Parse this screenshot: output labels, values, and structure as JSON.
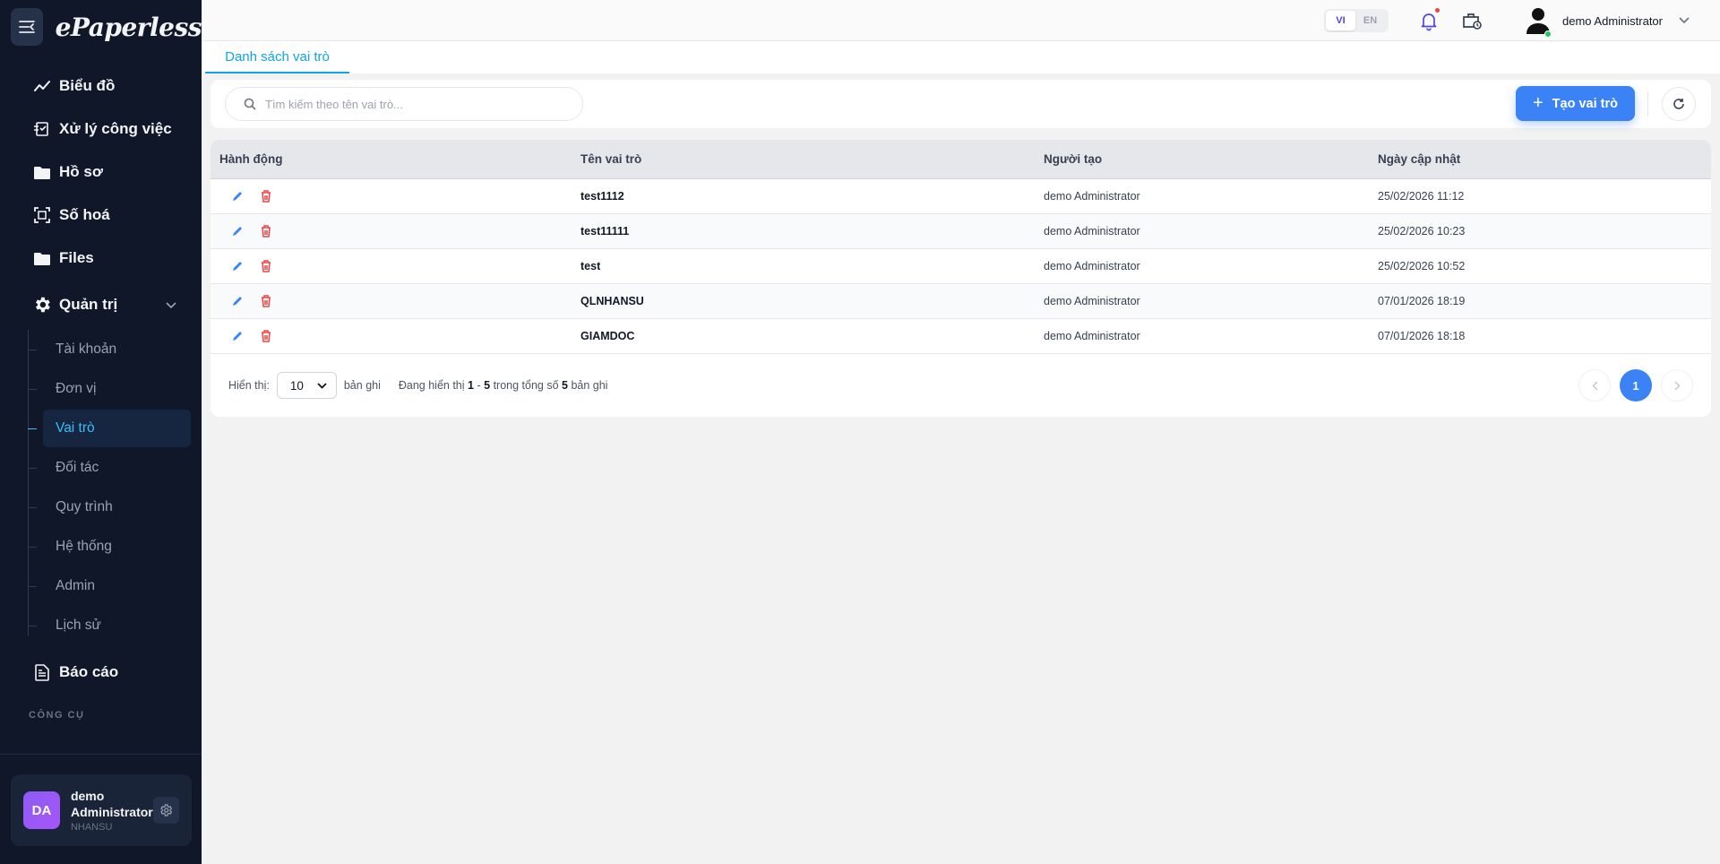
{
  "app": {
    "logo": "ePaperless"
  },
  "sidebar": {
    "items": [
      {
        "label": "Biểu đồ",
        "icon": "chart-line-icon"
      },
      {
        "label": "Xử lý công việc",
        "icon": "task-icon"
      },
      {
        "label": "Hồ sơ",
        "icon": "folder-icon"
      },
      {
        "label": "Số hoá",
        "icon": "scan-icon"
      },
      {
        "label": "Files",
        "icon": "folder-icon"
      }
    ],
    "admin_group": {
      "label": "Quản trị",
      "icon": "gear-icon",
      "children": [
        "Tài khoản",
        "Đơn vị",
        "Vai trò",
        "Đối tác",
        "Quy trình",
        "Hệ thống",
        "Admin",
        "Lịch sử"
      ],
      "active": "Vai trò"
    },
    "report": {
      "label": "Báo cáo",
      "icon": "report-icon"
    },
    "section_tools": "CÔNG CỤ",
    "user_card": {
      "initials": "DA",
      "name": "demo Administrator",
      "role": "NHANSU"
    }
  },
  "header": {
    "lang_vi": "VI",
    "lang_en": "EN",
    "active_lang": "VI",
    "user_name": "demo Administrator"
  },
  "tabs": [
    {
      "label": "Danh sách vai trò",
      "active": true
    }
  ],
  "toolbar": {
    "search_placeholder": "Tìm kiếm theo tên vai trò...",
    "create_label": "Tạo vai trò"
  },
  "table": {
    "headers": [
      "Hành động",
      "Tên vai trò",
      "Người tạo",
      "Ngày cập nhật"
    ],
    "rows": [
      {
        "name": "test1112",
        "creator": "demo Administrator",
        "updated": "25/02/2026 11:12"
      },
      {
        "name": "test11111",
        "creator": "demo Administrator",
        "updated": "25/02/2026 10:23"
      },
      {
        "name": "test",
        "creator": "demo Administrator",
        "updated": "25/02/2026 10:52"
      },
      {
        "name": "QLNHANSU",
        "creator": "demo Administrator",
        "updated": "07/01/2026 18:19"
      },
      {
        "name": "GIAMDOC",
        "creator": "demo Administrator",
        "updated": "07/01/2026 18:18"
      }
    ]
  },
  "pagination": {
    "show_label": "Hiển thị:",
    "page_size": "10",
    "records_label": "bản ghi",
    "info_prefix": "Đang hiển thị",
    "from": "1",
    "dash": "-",
    "to": "5",
    "info_mid": "trong tổng số",
    "total": "5",
    "info_suffix": "bản ghi",
    "current_page": "1"
  },
  "colors": {
    "primary": "#3b82f6",
    "sidebar_bg": "#0f1729",
    "active_link": "#38bdf8",
    "danger": "#ef4444"
  }
}
